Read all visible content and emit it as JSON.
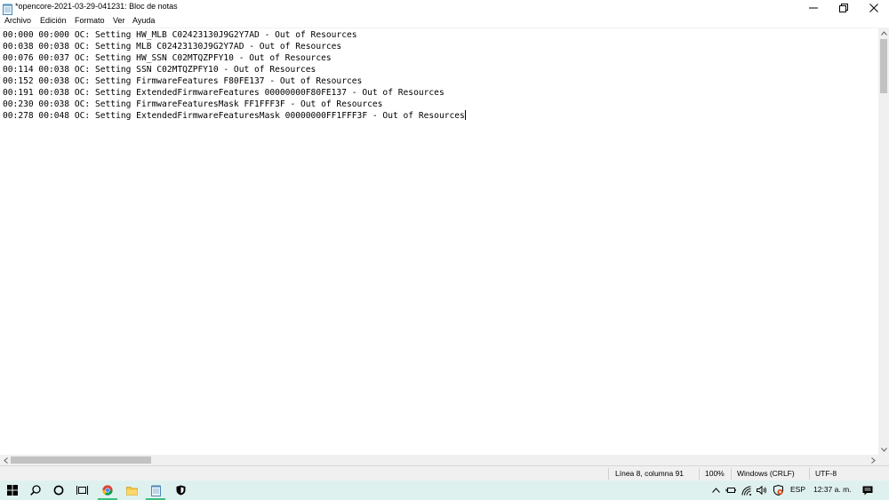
{
  "window": {
    "title": "*opencore-2021-03-29-041231: Bloc de notas"
  },
  "menu": [
    {
      "label": "Archivo"
    },
    {
      "label": "Edición"
    },
    {
      "label": "Formato"
    },
    {
      "label": "Ver"
    },
    {
      "label": "Ayuda"
    }
  ],
  "document": {
    "lines": [
      "00:000 00:000 OC: Setting HW_MLB C02423130J9G2Y7AD - Out of Resources",
      "00:038 00:038 OC: Setting MLB C02423130J9G2Y7AD - Out of Resources",
      "00:076 00:037 OC: Setting HW_SSN C02MTQZPFY10 - Out of Resources",
      "00:114 00:038 OC: Setting SSN C02MTQZPFY10 - Out of Resources",
      "00:152 00:038 OC: Setting FirmwareFeatures F80FE137 - Out of Resources",
      "00:191 00:038 OC: Setting ExtendedFirmwareFeatures 00000000F80FE137 - Out of Resources",
      "00:230 00:038 OC: Setting FirmwareFeaturesMask FF1FFF3F - Out of Resources",
      "00:278 00:048 OC: Setting ExtendedFirmwareFeaturesMask 00000000FF1FFF3F - Out of Resources"
    ]
  },
  "statusbar": {
    "position": "Línea 8, columna 91",
    "zoom": "100%",
    "line_ending": "Windows (CRLF)",
    "encoding": "UTF-8"
  },
  "tray": {
    "language": "ESP",
    "time": "12:37 a. m."
  },
  "colors": {
    "taskbar": "#dff1ee",
    "active_indicator": "#3cbf7d",
    "scroll_thumb": "#c2c2c2"
  }
}
